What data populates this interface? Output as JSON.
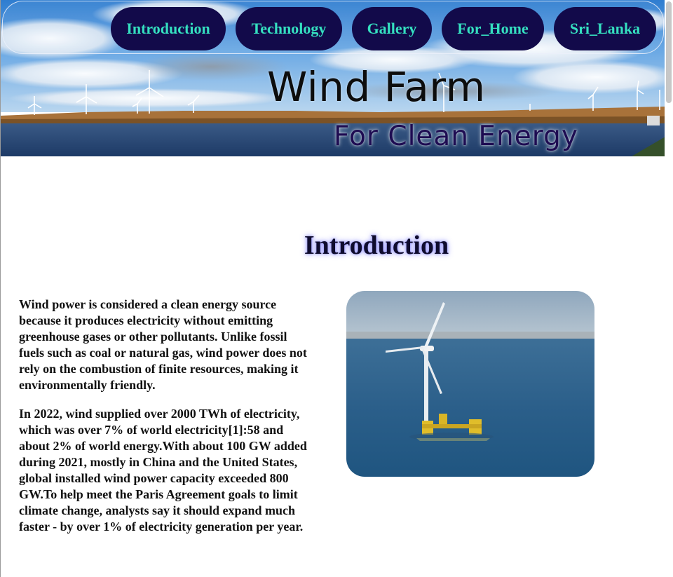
{
  "nav": {
    "items": [
      {
        "label": "Introduction"
      },
      {
        "label": "Technology"
      },
      {
        "label": "Gallery"
      },
      {
        "label": "For_Home"
      },
      {
        "label": "Sri_Lanka"
      }
    ]
  },
  "banner": {
    "title": "Wind Farm",
    "subtitle": "For Clean Energy"
  },
  "section": {
    "heading": "Introduction",
    "paragraphs": [
      "Wind power is considered a clean energy source because it produces electricity without emitting greenhouse gases or other pollutants. Unlike fossil fuels such as coal or natural gas, wind power does not rely on the combustion of finite resources, making it environmentally friendly.",
      "In 2022, wind supplied over 2000 TWh of electricity, which was over 7% of world electricity[1]:58 and about 2% of world energy.With about 100 GW added during 2021, mostly in China and the United States, global installed wind power capacity exceeded 800 GW.To help meet the Paris Agreement goals to limit climate change, analysts say it should expand much faster - by over 1% of electricity generation per year."
    ]
  },
  "colors": {
    "nav_bg": "#120a4a",
    "nav_text": "#35e0c0",
    "title": "#0d0d0d",
    "subtitle": "#1e0c52",
    "heading_glow": "#5a5aff"
  }
}
